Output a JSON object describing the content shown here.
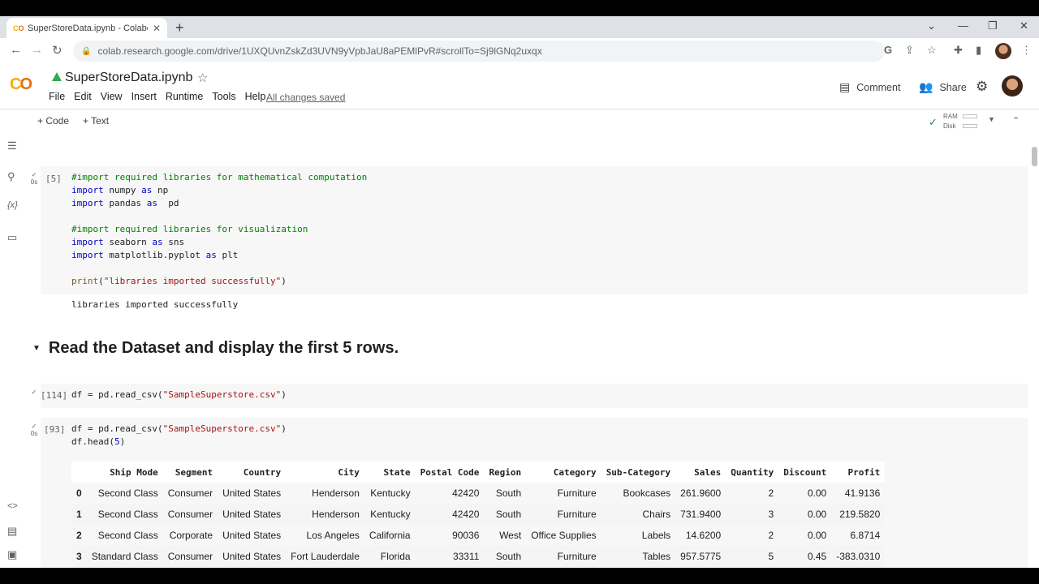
{
  "browser": {
    "tab_title": "SuperStoreData.ipynb - Colabora",
    "url": "colab.research.google.com/drive/1UXQUvnZskZd3UVN9yVpbJaU8aPEMlPvR#scrollTo=Sj9lGNq2uxqx"
  },
  "notebook": {
    "title": "SuperStoreData.ipynb",
    "menu": [
      "File",
      "Edit",
      "View",
      "Insert",
      "Runtime",
      "Tools",
      "Help"
    ],
    "saved_status": "All changes saved",
    "comment_label": "Comment",
    "share_label": "Share",
    "add_code": "+ Code",
    "add_text": "+ Text",
    "ram_label": "RAM",
    "disk_label": "Disk"
  },
  "cells": {
    "c1": {
      "exec_count": "[5]",
      "exec_time": "0s",
      "output": "libraries imported successfully"
    },
    "heading": "Read the Dataset and display the first 5 rows.",
    "c2": {
      "exec_count": "[114]"
    },
    "c3": {
      "exec_count": "[93]",
      "exec_time": "0s"
    }
  },
  "table": {
    "columns": [
      "",
      "Ship Mode",
      "Segment",
      "Country",
      "City",
      "State",
      "Postal Code",
      "Region",
      "Category",
      "Sub-Category",
      "Sales",
      "Quantity",
      "Discount",
      "Profit"
    ],
    "rows": [
      [
        "0",
        "Second Class",
        "Consumer",
        "United States",
        "Henderson",
        "Kentucky",
        "42420",
        "South",
        "Furniture",
        "Bookcases",
        "261.9600",
        "2",
        "0.00",
        "41.9136"
      ],
      [
        "1",
        "Second Class",
        "Consumer",
        "United States",
        "Henderson",
        "Kentucky",
        "42420",
        "South",
        "Furniture",
        "Chairs",
        "731.9400",
        "3",
        "0.00",
        "219.5820"
      ],
      [
        "2",
        "Second Class",
        "Corporate",
        "United States",
        "Los Angeles",
        "California",
        "90036",
        "West",
        "Office Supplies",
        "Labels",
        "14.6200",
        "2",
        "0.00",
        "6.8714"
      ],
      [
        "3",
        "Standard Class",
        "Consumer",
        "United States",
        "Fort Lauderdale",
        "Florida",
        "33311",
        "South",
        "Furniture",
        "Tables",
        "957.5775",
        "5",
        "0.45",
        "-383.0310"
      ]
    ]
  },
  "icons": {
    "back": "arrow-left-icon",
    "forward": "arrow-right-icon",
    "reload": "reload-icon",
    "lock": "lock-icon",
    "settings": "gear-icon",
    "toc": "list-icon",
    "search": "search-icon",
    "variables": "variables-icon",
    "files": "folder-icon"
  },
  "colors": {
    "accent_orange": "#f9ab00",
    "comment_green": "#008000",
    "keyword_blue": "#0000c0",
    "string_red": "#a31515"
  }
}
